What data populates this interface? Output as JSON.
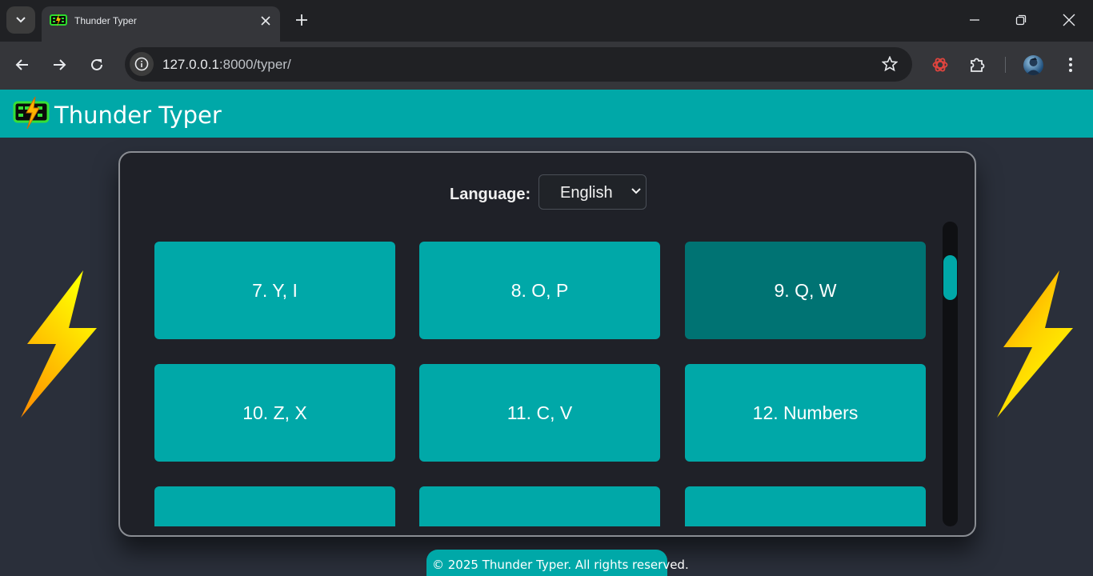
{
  "browser": {
    "tab_title": "Thunder Typer",
    "url_host": "127.0.0.1",
    "url_path": ":8000/typer/"
  },
  "app": {
    "title": "Thunder Typer",
    "brand_color": "#00a8a8",
    "active_color": "#007373"
  },
  "language": {
    "label": "Language:",
    "selected": "English"
  },
  "lessons": [
    {
      "label": "7. Y, I",
      "active": false
    },
    {
      "label": "8. O, P",
      "active": false
    },
    {
      "label": "9. Q, W",
      "active": true
    },
    {
      "label": "10. Z, X",
      "active": false
    },
    {
      "label": "11. C, V",
      "active": false
    },
    {
      "label": "12. Numbers",
      "active": false
    },
    {
      "label": "",
      "active": false
    },
    {
      "label": "",
      "active": false
    },
    {
      "label": "",
      "active": false
    }
  ],
  "footer": {
    "text": "© 2025 Thunder Typer. All rights reserved."
  }
}
